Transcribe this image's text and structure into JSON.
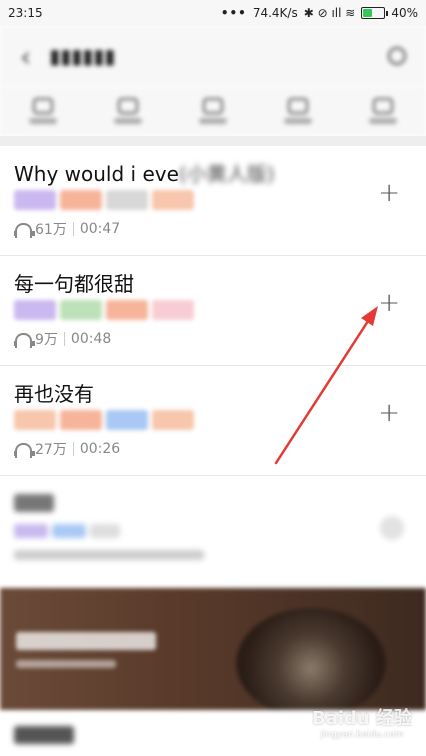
{
  "status_bar": {
    "time": "23:15",
    "dots": "•••",
    "speed": "74.4K/s",
    "signal_icons": "✱ ⊘ ıll ≋",
    "battery": "40%"
  },
  "songs": [
    {
      "title_visible": "Why would i eve",
      "title_blurred": "(小黄人版)",
      "plays": "61万",
      "duration": "00:47",
      "tag_colors": [
        "#cbb8f0",
        "#f6b49a",
        "#d7d7d7",
        "#f7c6ac"
      ]
    },
    {
      "title_visible": "每一句都很甜",
      "title_blurred": "",
      "plays": "9万",
      "duration": "00:48",
      "tag_colors": [
        "#cbb8f0",
        "#bde1b8",
        "#f6b49a",
        "#f7cdd3"
      ]
    },
    {
      "title_visible": "再也没有",
      "title_blurred": "",
      "plays": "27万",
      "duration": "00:26",
      "tag_colors": [
        "#f7c6ac",
        "#f6b49a",
        "#a9c8f4",
        "#f7c6ac"
      ]
    }
  ],
  "add_symbol": "+",
  "watermark": {
    "brand": "Baidu 经验",
    "url": "jingyan.baidu.com"
  },
  "colors": {
    "annotation_arrow": "#e53935",
    "divider": "#eeeeee"
  },
  "icons": [
    "back-arrow-icon",
    "search-icon",
    "headphone-icon",
    "add-icon"
  ]
}
